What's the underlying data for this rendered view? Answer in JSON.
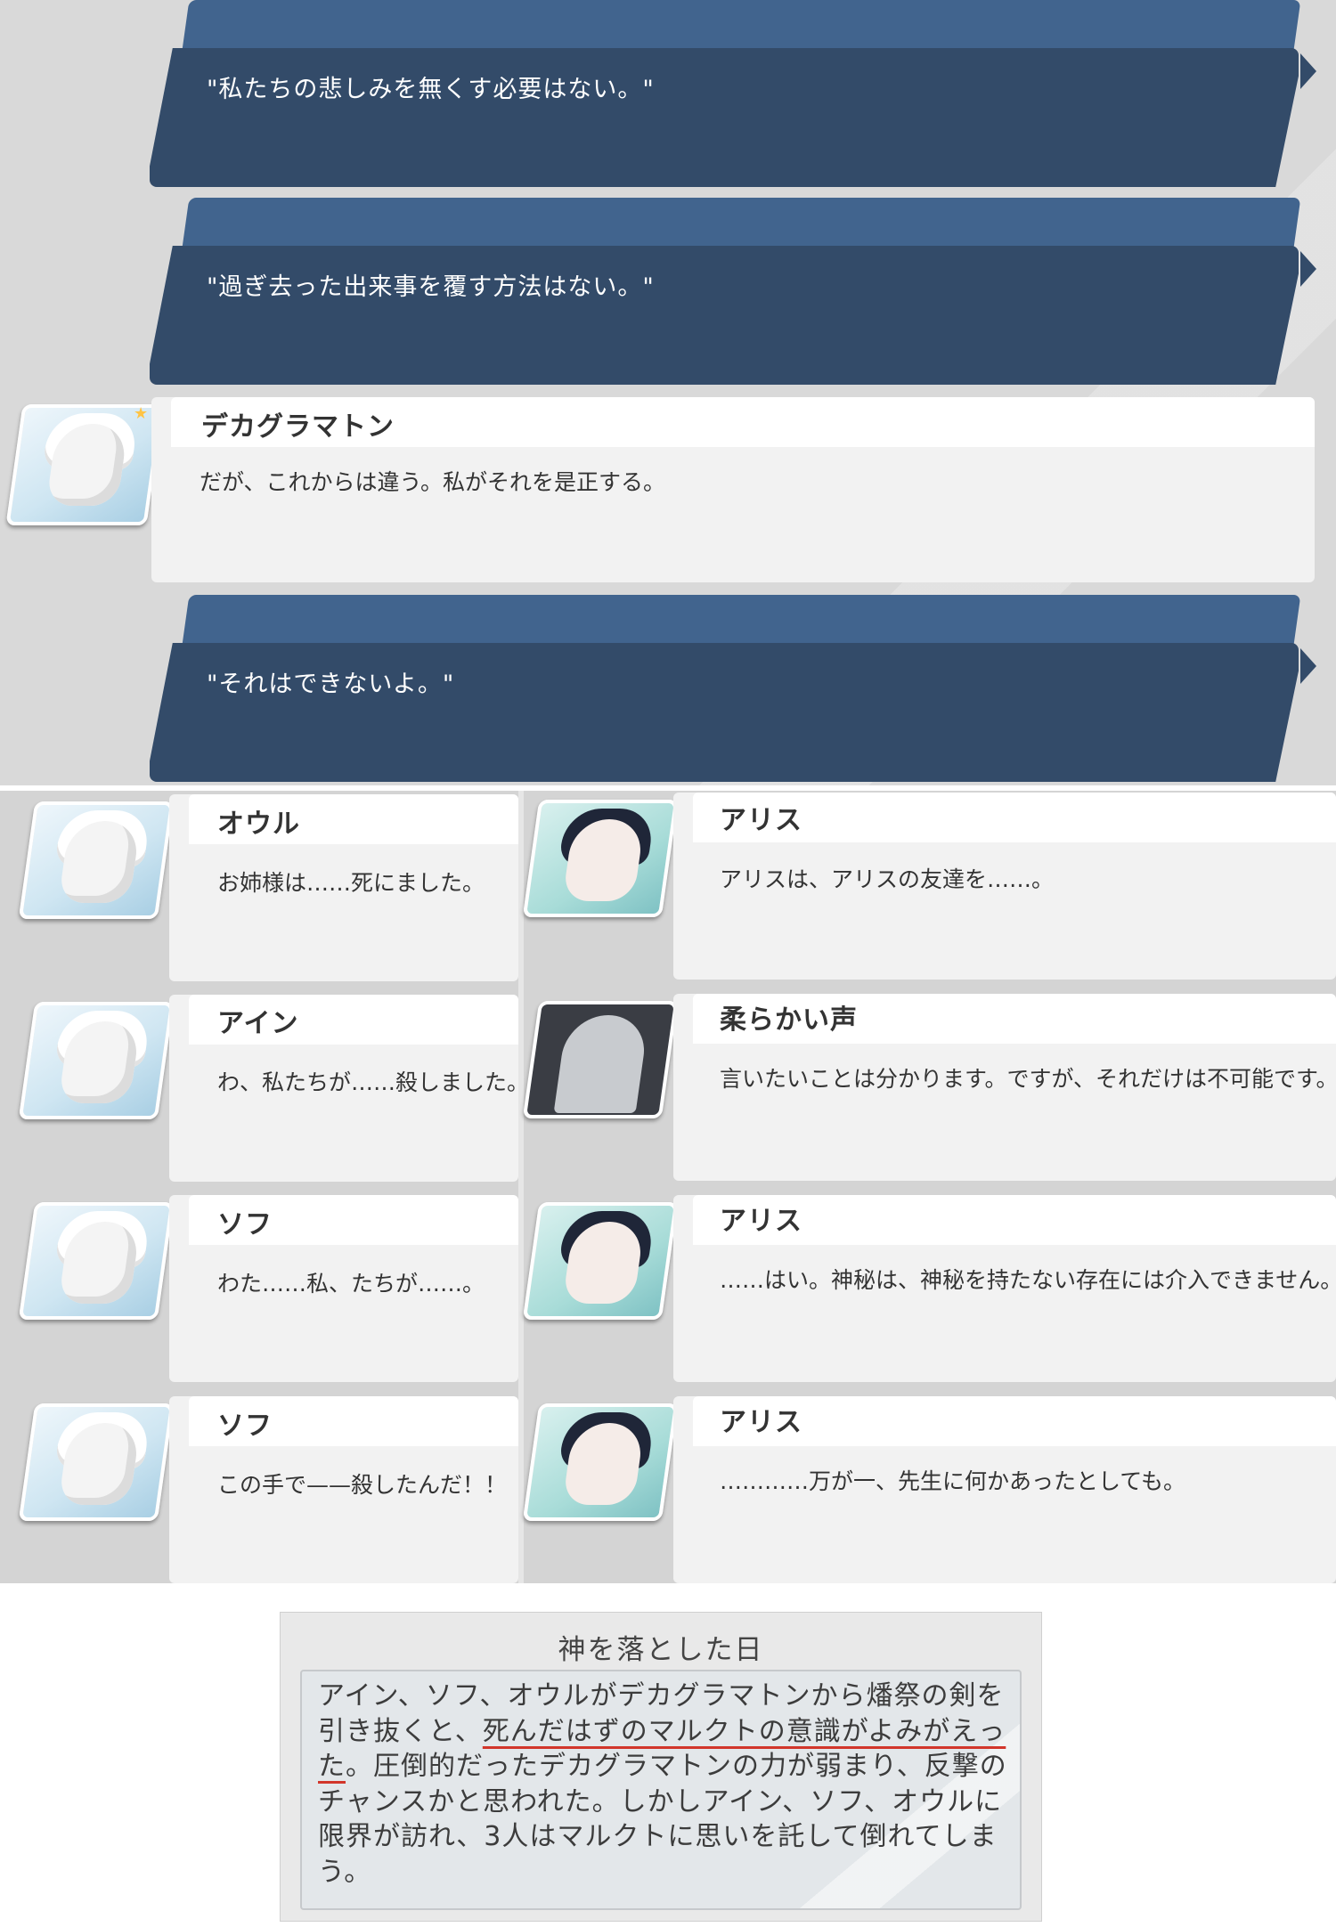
{
  "narration": [
    {
      "text": "\"私たちの悲しみを無くす必要はない。\""
    },
    {
      "text": "\"過ぎ去った出来事を覆す方法はない。\""
    },
    {
      "text": "\"それはできないよ。\""
    }
  ],
  "top_dialogue": {
    "speaker": "デカグラマトン",
    "line": "だが、これからは違う。私がそれを是正する。"
  },
  "grid_left": [
    {
      "speaker": "オウル",
      "line": "お姉様は……死にました。"
    },
    {
      "speaker": "アイン",
      "line": "わ、私たちが……殺しました。"
    },
    {
      "speaker": "ソフ",
      "line": "わた……私、たちが……。"
    },
    {
      "speaker": "ソフ",
      "line": "この手で——殺したんだ！！"
    }
  ],
  "grid_right": [
    {
      "speaker": "アリス",
      "line": "アリスは、アリスの友達を……。"
    },
    {
      "speaker": "柔らかい声",
      "line": "言いたいことは分かります。ですが、それだけは不可能です。"
    },
    {
      "speaker": "アリス",
      "line": "……はい。神秘は、神秘を持たない存在には介入できません。"
    },
    {
      "speaker": "アリス",
      "line": "…………万が一、先生に何かあったとしても。"
    }
  ],
  "info": {
    "title": "神を落とした日",
    "desc_pre": "アイン、ソフ、オウルがデカグラマトンから燔祭の剣を引き抜くと、",
    "desc_highlight": "死んだはずのマルクトの意識がよみがえった",
    "desc_post": "。圧倒的だったデカグラマトンの力が弱まり、反撃のチャンスかと思われた。しかしアイン、ソフ、オウルに限界が訪れ、3人はマルクトに思いを託して倒れてしまう。"
  },
  "colors": {
    "narration_header": "#41648e",
    "narration_body": "#334b69",
    "highlight_underline": "#d2362b"
  },
  "icons": [
    "character-portrait",
    "silhouette-portrait",
    "narration-arrow-icon",
    "star-icon"
  ]
}
